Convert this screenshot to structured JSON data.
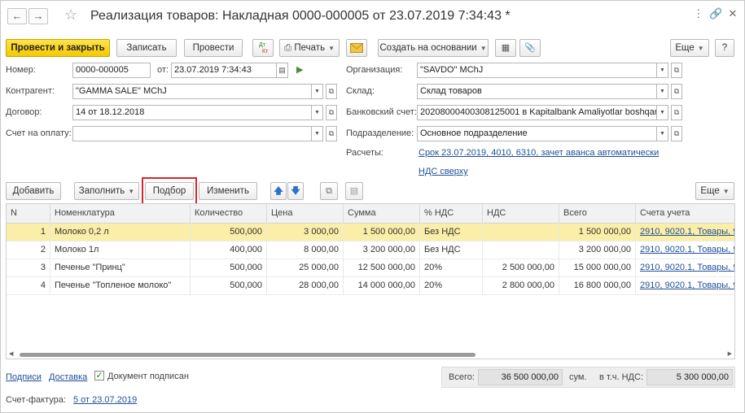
{
  "window": {
    "title": "Реализация товаров: Накладная 0000-000005 от 23.07.2019 7:34:43 *",
    "back_icon": "arrow-left-icon",
    "forward_icon": "arrow-right-icon",
    "favorite_icon": "star-icon",
    "menu_icon": "more-vertical-icon",
    "link_icon": "link-icon",
    "close_icon": "close-icon"
  },
  "toolbar": {
    "post_close": "Провести и закрыть",
    "save": "Записать",
    "post": "Провести",
    "dt_kt_icon": "Дт Кт",
    "print": "Печать",
    "mail_icon": "envelope-icon",
    "create_based": "Создать на основании",
    "more": "Еще",
    "help": "?"
  },
  "form": {
    "number_label": "Номер:",
    "number": "0000-000005",
    "date_label": "от:",
    "date": "23.07.2019  7:34:43",
    "org_label": "Организация:",
    "org": "\"SAVDO\" MChJ",
    "contragent_label": "Контрагент:",
    "contragent": "\"GAMMA SALE\" MChJ",
    "warehouse_label": "Склад:",
    "warehouse": "Склад товаров",
    "contract_label": "Договор:",
    "contract": "14 от 18.12.2018",
    "bank_label": "Банковский счет:",
    "bank": "20208000400308125001 в Kapitalbank Amaliyotlar boshqarr",
    "invoice_label": "Счет на оплату:",
    "invoice": "",
    "division_label": "Подразделение:",
    "division": "Основное подразделение",
    "settlements_label": "Расчеты:",
    "settlements_link": "Срок 23.07.2019, 4010, 6310, зачет аванса автоматически",
    "vat_link": "НДС сверху"
  },
  "table_toolbar": {
    "add": "Добавить",
    "fill": "Заполнить",
    "pick": "Подбор",
    "change": "Изменить",
    "more": "Еще"
  },
  "table": {
    "columns": [
      "N",
      "Номенклатура",
      "Количество",
      "Цена",
      "Сумма",
      "% НДС",
      "НДС",
      "Всего",
      "Счета учета"
    ],
    "rows": [
      {
        "n": "1",
        "name": "Молоко 0,2 л",
        "qty": "500,000",
        "price": "3 000,00",
        "sum": "1 500 000,00",
        "vat_rate": "Без НДС",
        "vat": "",
        "total": "1 500 000,00",
        "accounts": "2910, 9020.1, Товары, 9"
      },
      {
        "n": "2",
        "name": "Молоко 1л",
        "qty": "400,000",
        "price": "8 000,00",
        "sum": "3 200 000,00",
        "vat_rate": "Без НДС",
        "vat": "",
        "total": "3 200 000,00",
        "accounts": "2910, 9020.1, Товары, 9"
      },
      {
        "n": "3",
        "name": "Печенье \"Принц\"",
        "qty": "500,000",
        "price": "25 000,00",
        "sum": "12 500 000,00",
        "vat_rate": "20%",
        "vat": "2 500 000,00",
        "total": "15 000 000,00",
        "accounts": "2910, 9020.1, Товары, 9"
      },
      {
        "n": "4",
        "name": "Печенье \"Топленое молоко\"",
        "qty": "500,000",
        "price": "28 000,00",
        "sum": "14 000 000,00",
        "vat_rate": "20%",
        "vat": "2 800 000,00",
        "total": "16 800 000,00",
        "accounts": "2910, 9020.1, Товары, 9"
      }
    ]
  },
  "footer": {
    "signatures": "Подписи",
    "delivery": "Доставка",
    "signed_label": "Документ подписан",
    "total_label": "Всего:",
    "total": "36 500 000,00",
    "currency": "сум.",
    "vat_incl_label": "в т.ч. НДС:",
    "vat_total": "5 300 000,00",
    "invoice_label": "Счет-фактура:",
    "invoice_link": "5 от 23.07.2019"
  },
  "colors": {
    "primary_button": "#f5c900",
    "selected_row": "#fbeea8",
    "link": "#1f4f99",
    "highlight_box": "#d8262f"
  }
}
